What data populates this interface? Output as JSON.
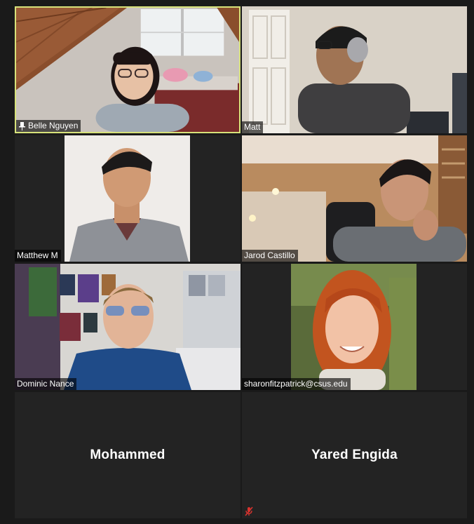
{
  "app": {
    "name": "Zoom gallery view"
  },
  "colors": {
    "background": "#1a1a1a",
    "tile": "#232323",
    "active_speaker_border": "#d7e27a",
    "muted_red": "#d9332e"
  },
  "participants": [
    {
      "name": "Belle Nguyen",
      "pinned": true,
      "active_speaker": true,
      "video_on": true
    },
    {
      "name": "Matt",
      "video_on": true
    },
    {
      "name": "Matthew M",
      "video_on": true
    },
    {
      "name": "Jarod Castillo",
      "video_on": true
    },
    {
      "name": "Dominic Nance",
      "video_on": true
    },
    {
      "name": "sharonfitzpatrick@csus.edu",
      "video_on": true
    },
    {
      "name": "Mohammed",
      "video_on": false
    },
    {
      "name": "Yared Engida",
      "video_on": false,
      "muted": true
    }
  ],
  "icons": {
    "pin": "pin-icon",
    "muted": "microphone-muted-icon"
  }
}
